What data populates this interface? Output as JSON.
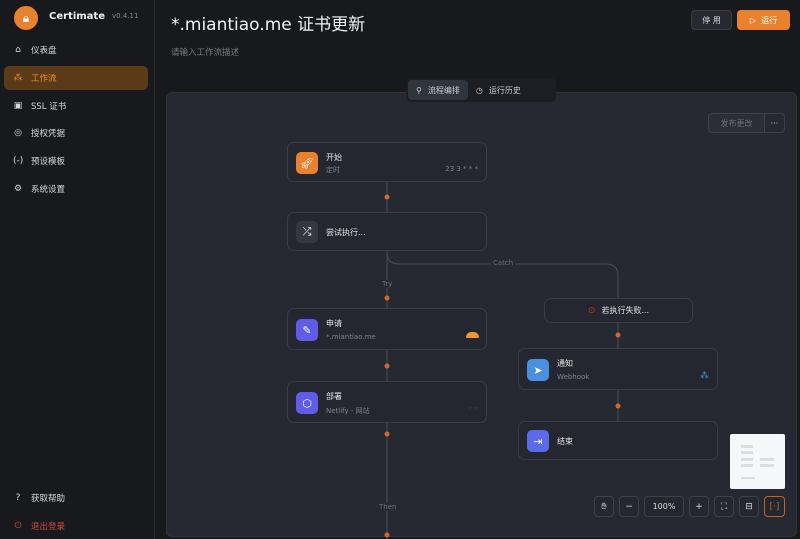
{
  "app": {
    "name": "Certimate",
    "version": "v0.4.11"
  },
  "sidebar": {
    "items": [
      {
        "label": "仪表盘",
        "icon": "home-icon"
      },
      {
        "label": "工作流",
        "icon": "workflow-icon",
        "active": true
      },
      {
        "label": "SSL 证书",
        "icon": "certificate-icon"
      },
      {
        "label": "授权凭据",
        "icon": "fingerprint-icon"
      },
      {
        "label": "预设模板",
        "icon": "braces-icon"
      },
      {
        "label": "系统设置",
        "icon": "gear-icon"
      }
    ],
    "footer": [
      {
        "label": "获取帮助",
        "icon": "help-icon"
      },
      {
        "label": "退出登录",
        "icon": "power-icon"
      }
    ]
  },
  "header": {
    "title": "*.miantiao.me 证书更新",
    "description_placeholder": "请输入工作流描述",
    "disable_label": "停 用",
    "run_label": "运行"
  },
  "tabs": [
    {
      "label": "流程编排",
      "active": true
    },
    {
      "label": "运行历史"
    }
  ],
  "toolbar": {
    "publish_label": "发布更改",
    "more_label": "···"
  },
  "nodes": {
    "start": {
      "title": "开始",
      "subtitle": "定时",
      "cron": "23 3 * * *"
    },
    "try": {
      "title": "尝试执行..."
    },
    "apply": {
      "title": "申请",
      "subtitle": "*.miantiao.me",
      "provider_icon": "cloudflare-icon"
    },
    "deploy": {
      "title": "部署",
      "subtitle": "Netlify - 网站"
    },
    "catch": {
      "title": "若执行失败..."
    },
    "notify": {
      "title": "通知",
      "subtitle": "Webhook",
      "provider_icon": "webhook-icon"
    },
    "end": {
      "title": "结束"
    }
  },
  "edges": {
    "try_label": "Try",
    "catch_label": "Catch",
    "then_label": "Then"
  },
  "zoom": {
    "level": "100%"
  },
  "colors": {
    "accent": "#e8822e",
    "node_icon": "#5f5ce8",
    "notify_icon": "#4a8fe0"
  }
}
